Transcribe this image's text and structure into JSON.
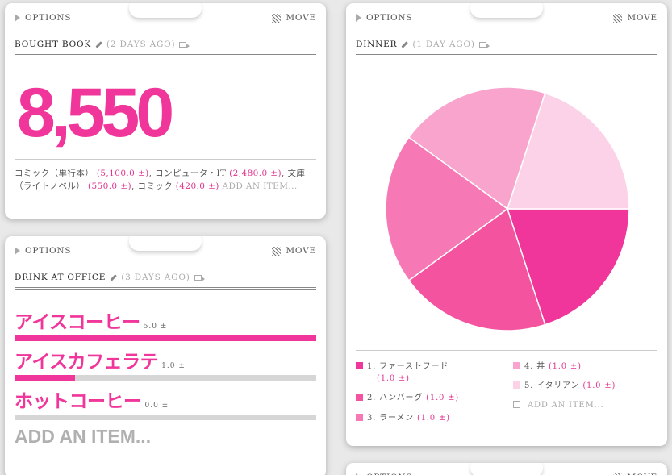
{
  "colors": {
    "accent": "#f0359b",
    "bar_bg": "#d6d6d6"
  },
  "common": {
    "options": "OPTIONS",
    "move": "MOVE"
  },
  "book": {
    "title": "BOUGHT BOOK",
    "ago": "(2 DAYS AGO)",
    "total": "8,550",
    "items": [
      {
        "label": "コミック（単行本）",
        "amount": "(5,100.0 ±)"
      },
      {
        "label": "コンピュータ・IT",
        "amount": "(2,480.0 ±)"
      },
      {
        "label": "文庫（ライトノベル）",
        "amount": "(550.0 ±)"
      },
      {
        "label": "コミック",
        "amount": "(420.0 ±)"
      }
    ],
    "add": "ADD AN ITEM..."
  },
  "drink": {
    "title": "DRINK AT OFFICE",
    "ago": "(3 DAYS AGO)",
    "items": [
      {
        "name": "アイスコーヒー",
        "count": "5.0 ±",
        "level": 1.0
      },
      {
        "name": "アイスカフェラテ",
        "count": "1.0 ±",
        "level": 0.2
      },
      {
        "name": "ホットコーヒー",
        "count": "0.0 ±",
        "level": 0.0
      }
    ],
    "add": "ADD AN ITEM..."
  },
  "dinner": {
    "title": "DINNER",
    "ago": "(1 DAY AGO)",
    "legend": [
      {
        "rank": "1.",
        "label": "ファーストフード",
        "amount": "(1.0 ±)",
        "color": "#f0359b"
      },
      {
        "rank": "2.",
        "label": "ハンバーグ",
        "amount": "(1.0 ±)",
        "color": "#f4549f"
      },
      {
        "rank": "3.",
        "label": "ラーメン",
        "amount": "(1.0 ±)",
        "color": "#f679b6"
      },
      {
        "rank": "4.",
        "label": "丼",
        "amount": "(1.0 ±)",
        "color": "#f8a4cc"
      },
      {
        "rank": "5.",
        "label": "イタリアン",
        "amount": "(1.0 ±)",
        "color": "#fbd2e7"
      }
    ],
    "add": "ADD AN ITEM..."
  },
  "chart_data": {
    "type": "pie",
    "categories": [
      "ファーストフード",
      "ハンバーグ",
      "ラーメン",
      "丼",
      "イタリアン"
    ],
    "values": [
      1,
      1,
      1,
      1,
      1
    ],
    "colors": [
      "#f0359b",
      "#f4549f",
      "#f679b6",
      "#f8a4cc",
      "#fbd2e7"
    ]
  }
}
